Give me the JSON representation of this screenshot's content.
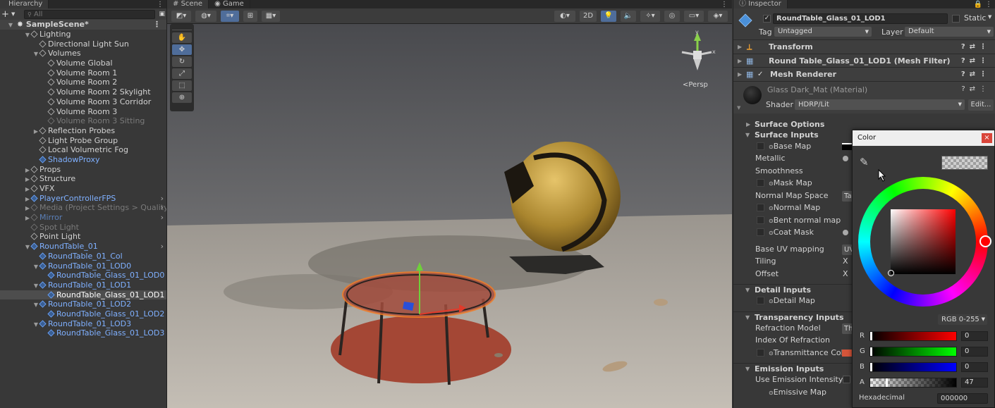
{
  "hierarchy": {
    "tab": "Hierarchy",
    "search_placeholder": "All",
    "scene": "SampleScene*",
    "items": [
      {
        "label": "Lighting",
        "depth": 1,
        "arrow": "▼",
        "style": "normal"
      },
      {
        "label": "Directional Light Sun",
        "depth": 2,
        "arrow": "",
        "style": "normal"
      },
      {
        "label": "Volumes",
        "depth": 2,
        "arrow": "▼",
        "style": "normal"
      },
      {
        "label": "Volume Global",
        "depth": 3,
        "arrow": "",
        "style": "normal"
      },
      {
        "label": "Volume Room 1",
        "depth": 3,
        "arrow": "",
        "style": "normal"
      },
      {
        "label": "Volume Room 2",
        "depth": 3,
        "arrow": "",
        "style": "normal"
      },
      {
        "label": "Volume Room 2 Skylight",
        "depth": 3,
        "arrow": "",
        "style": "normal"
      },
      {
        "label": "Volume Room 3 Corridor",
        "depth": 3,
        "arrow": "",
        "style": "normal"
      },
      {
        "label": "Volume Room 3",
        "depth": 3,
        "arrow": "",
        "style": "normal"
      },
      {
        "label": "Volume Room 3 Sitting",
        "depth": 3,
        "arrow": "",
        "style": "dim"
      },
      {
        "label": "Reflection Probes",
        "depth": 2,
        "arrow": "▶",
        "style": "normal"
      },
      {
        "label": "Light Probe Group",
        "depth": 2,
        "arrow": "",
        "style": "normal"
      },
      {
        "label": "Local Volumetric Fog",
        "depth": 2,
        "arrow": "",
        "style": "normal"
      },
      {
        "label": "ShadowProxy",
        "depth": 2,
        "arrow": "",
        "style": "blue"
      },
      {
        "label": "Props",
        "depth": 1,
        "arrow": "▶",
        "style": "normal"
      },
      {
        "label": "Structure",
        "depth": 1,
        "arrow": "▶",
        "style": "normal"
      },
      {
        "label": "VFX",
        "depth": 1,
        "arrow": "▶",
        "style": "normal"
      },
      {
        "label": "PlayerControllerFPS",
        "depth": 1,
        "arrow": "▶",
        "style": "blue"
      },
      {
        "label": "Media (Project Settings > Quality",
        "depth": 1,
        "arrow": "▶",
        "style": "dim"
      },
      {
        "label": "Mirror",
        "depth": 1,
        "arrow": "▶",
        "style": "dimblue"
      },
      {
        "label": "Spot Light",
        "depth": 1,
        "arrow": "",
        "style": "dim"
      },
      {
        "label": "Point Light",
        "depth": 1,
        "arrow": "",
        "style": "normal"
      },
      {
        "label": "RoundTable_01",
        "depth": 1,
        "arrow": "▼",
        "style": "blue"
      },
      {
        "label": "RoundTable_01_Col",
        "depth": 2,
        "arrow": "",
        "style": "blue"
      },
      {
        "label": "RoundTable_01_LOD0",
        "depth": 2,
        "arrow": "▼",
        "style": "blue"
      },
      {
        "label": "RoundTable_Glass_01_LOD0",
        "depth": 3,
        "arrow": "",
        "style": "blue"
      },
      {
        "label": "RoundTable_01_LOD1",
        "depth": 2,
        "arrow": "▼",
        "style": "blue"
      },
      {
        "label": "RoundTable_Glass_01_LOD1",
        "depth": 3,
        "arrow": "",
        "style": "selected"
      },
      {
        "label": "RoundTable_01_LOD2",
        "depth": 2,
        "arrow": "▼",
        "style": "blue"
      },
      {
        "label": "RoundTable_Glass_01_LOD2",
        "depth": 3,
        "arrow": "",
        "style": "blue"
      },
      {
        "label": "RoundTable_01_LOD3",
        "depth": 2,
        "arrow": "▼",
        "style": "blue"
      },
      {
        "label": "RoundTable_Glass_01_LOD3",
        "depth": 3,
        "arrow": "",
        "style": "blue"
      }
    ]
  },
  "scene": {
    "tab_scene": "Scene",
    "tab_game": "Game",
    "btn_2d": "2D",
    "persp": "<Persp"
  },
  "inspector": {
    "tab": "Inspector",
    "object_name": "RoundTable_Glass_01_LOD1",
    "static_label": "Static",
    "tag_label": "Tag",
    "tag_value": "Untagged",
    "layer_label": "Layer",
    "layer_value": "Default",
    "components": {
      "transform": "Transform",
      "mesh_filter": "Round Table_Glass_01_LOD1 (Mesh Filter)",
      "mesh_renderer": "Mesh Renderer"
    },
    "material": {
      "name": "Glass Dark_Mat (Material)",
      "shader_label": "Shader",
      "shader_value": "HDRP/Lit",
      "edit_label": "Edit..."
    },
    "sections": {
      "surface_options": "Surface Options",
      "surface_inputs": "Surface Inputs",
      "detail_inputs": "Detail Inputs",
      "transparency_inputs": "Transparency Inputs",
      "emission_inputs": "Emission Inputs"
    },
    "props": {
      "base_map": "Base Map",
      "metallic": "Metallic",
      "smoothness": "Smoothness",
      "mask_map": "Mask Map",
      "normal_space": "Normal Map Space",
      "normal_space_value": "Ta",
      "normal_map": "Normal Map",
      "bent_normal": "Bent normal map",
      "coat_mask": "Coat Mask",
      "base_uv": "Base UV mapping",
      "base_uv_value": "UV",
      "tiling": "Tiling",
      "offset": "Offset",
      "axis_x": "X",
      "detail_map": "Detail Map",
      "refraction_model": "Refraction Model",
      "refraction_value": "Th",
      "ior": "Index Of Refraction",
      "transmittance": "Transmittance Colo",
      "use_emission": "Use Emission Intensity",
      "emissive_map": "Emissive Map"
    }
  },
  "color_picker": {
    "title": "Color",
    "mode": "RGB 0-255",
    "channels": [
      {
        "label": "R",
        "value": "0"
      },
      {
        "label": "G",
        "value": "0"
      },
      {
        "label": "B",
        "value": "0"
      },
      {
        "label": "A",
        "value": "47"
      }
    ],
    "hex_label": "Hexadecimal",
    "hex_value": "000000",
    "hue_color": "#ff0000"
  }
}
